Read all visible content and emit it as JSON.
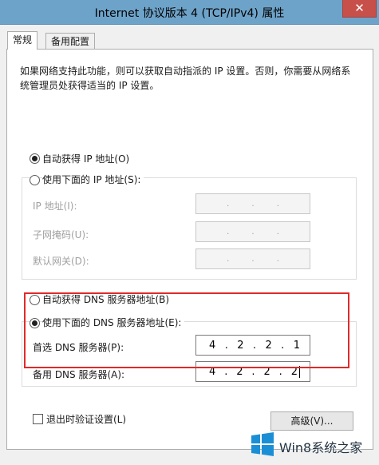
{
  "window": {
    "title": "Internet 协议版本 4 (TCP/IPv4) 属性",
    "close_glyph": "✕"
  },
  "tabs": [
    {
      "label": "常规"
    },
    {
      "label": "备用配置"
    }
  ],
  "description": "如果网络支持此功能，则可以获取自动指派的 IP 设置。否则，你需要从网络系统管理员处获得适当的 IP 设置。",
  "ip_mode": {
    "auto_label": "自动获得 IP 地址(O)",
    "manual_label": "使用下面的 IP 地址(S):",
    "selected": "auto"
  },
  "ip_fields": {
    "ip_label": "IP 地址(I):",
    "mask_label": "子网掩码(U):",
    "gateway_label": "默认网关(D):",
    "dot": "."
  },
  "dns_mode": {
    "auto_label": "自动获得 DNS 服务器地址(B)",
    "manual_label": "使用下面的 DNS 服务器地址(E):",
    "selected": "manual"
  },
  "dns_fields": {
    "preferred_label": "首选 DNS 服务器(P):",
    "preferred_octets": [
      "4",
      "2",
      "2",
      "1"
    ],
    "alternate_label": "备用 DNS 服务器(A):",
    "alternate_octets": [
      "4",
      "2",
      "2",
      "2"
    ],
    "dot": "."
  },
  "validate_on_exit": {
    "label": "退出时验证设置(L)",
    "checked": false
  },
  "advanced_button": "高级(V)...",
  "watermark": {
    "text": "Win8系统之家"
  },
  "colors": {
    "titlebar": "#6ea3c9",
    "close": "#c7504a",
    "highlight": "#e02a2a"
  }
}
